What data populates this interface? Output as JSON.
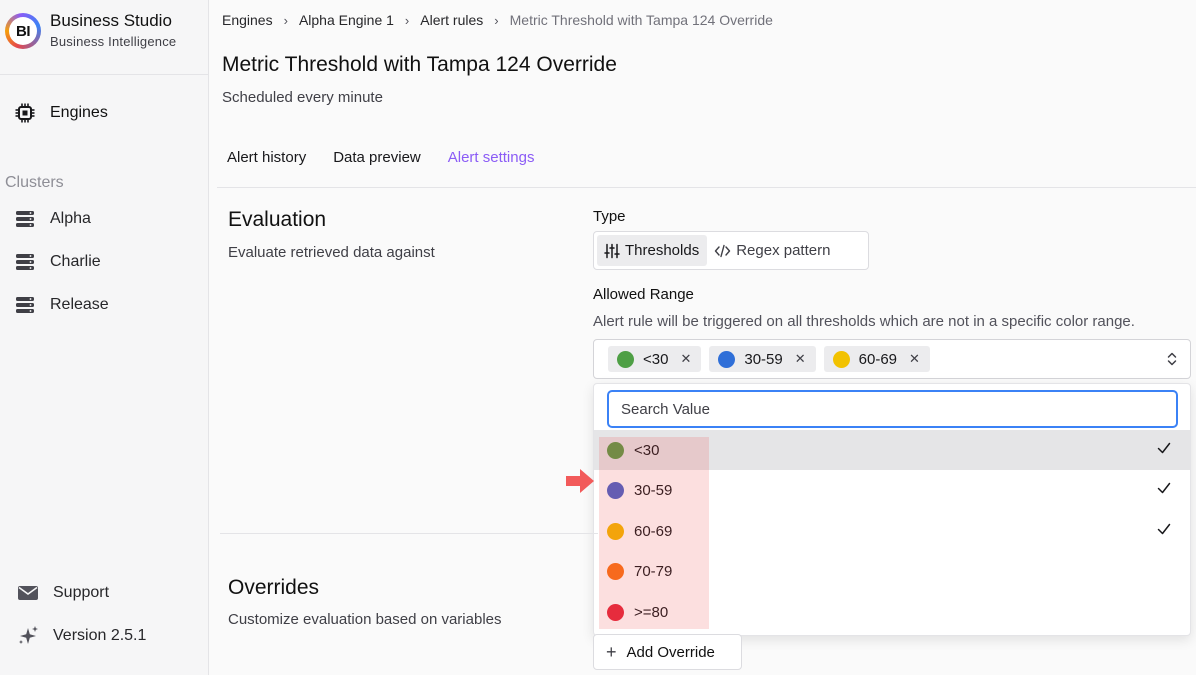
{
  "brand": {
    "logo_text": "BI",
    "title": "Business Studio",
    "subtitle": "Business Intelligence"
  },
  "sidebar": {
    "engines_label": "Engines",
    "clusters_heading": "Clusters",
    "clusters": [
      {
        "label": "Alpha",
        "icon": "database-icon"
      },
      {
        "label": "Charlie",
        "icon": "database-icon"
      },
      {
        "label": "Release",
        "icon": "database-icon"
      }
    ],
    "support_label": "Support",
    "version_label": "Version 2.5.1"
  },
  "breadcrumb": [
    "Engines",
    "Alpha Engine 1",
    "Alert rules",
    "Metric Threshold with Tampa 124 Override"
  ],
  "page": {
    "title": "Metric Threshold with Tampa 124 Override",
    "subtitle": "Scheduled every minute"
  },
  "tabs": [
    {
      "label": "Alert history",
      "active": false
    },
    {
      "label": "Data preview",
      "active": false
    },
    {
      "label": "Alert settings",
      "active": true
    }
  ],
  "evaluation": {
    "title": "Evaluation",
    "subtitle": "Evaluate retrieved data against",
    "type_label": "Type",
    "type_options": [
      "Thresholds",
      "Regex pattern"
    ],
    "type_selected": "Thresholds",
    "range_label": "Allowed Range",
    "range_help": "Alert rule will be triggered on all thresholds which are not in a specific color range.",
    "selected_chips": [
      {
        "label": "<30",
        "color": "#4e9f45"
      },
      {
        "label": "30-59",
        "color": "#2f6fd8"
      },
      {
        "label": "60-69",
        "color": "#f2c200"
      }
    ],
    "search_placeholder": "Search Value",
    "options": [
      {
        "label": "<30",
        "color": "#5c9a48",
        "checked": true
      },
      {
        "label": "30-59",
        "color": "#4a63c9",
        "checked": true
      },
      {
        "label": "60-69",
        "color": "#f5b800",
        "checked": true
      },
      {
        "label": "70-79",
        "color": "#f97316",
        "checked": false
      },
      {
        "label": ">=80",
        "color": "#e5283d",
        "checked": false
      }
    ]
  },
  "overrides": {
    "title": "Overrides",
    "subtitle": "Customize evaluation based on variables",
    "add_label": "Add Override"
  },
  "colors": {
    "accent": "#8b5cf6",
    "focus": "#3b82f6",
    "annotation": "#f25a5a"
  }
}
